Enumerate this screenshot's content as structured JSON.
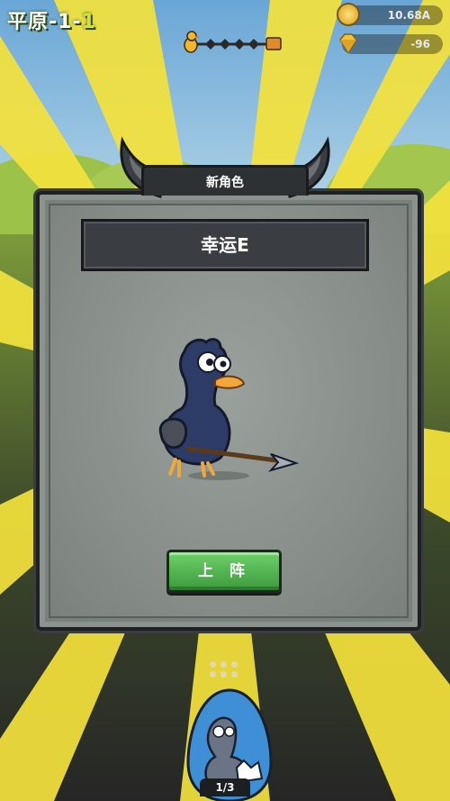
{
  "hud": {
    "stage_prefix": "平原-1-",
    "stage_suffix": "1",
    "gold": "10.68A",
    "gems": "-96"
  },
  "dialog": {
    "header": "新角色",
    "character_name": "幸运E",
    "deploy_label": "上 阵"
  },
  "egg": {
    "counter": "1/3"
  },
  "colors": {
    "ray": "#f4e23c",
    "dialog_bg": "#7a807c",
    "button_green": "#4cb04a"
  }
}
